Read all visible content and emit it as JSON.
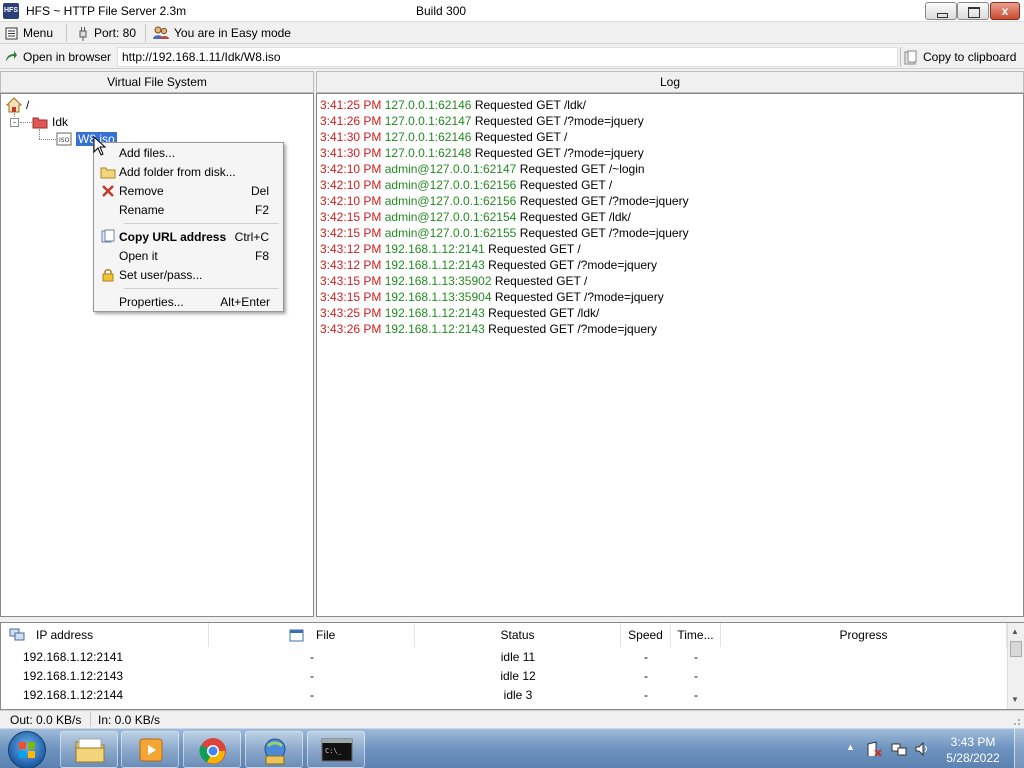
{
  "window": {
    "title": "HFS ~ HTTP File Server 2.3m",
    "build": "Build 300",
    "close_label": "x"
  },
  "toolbar": {
    "menu_label": "Menu",
    "port_label": "Port: 80",
    "mode_label": "You are in Easy mode"
  },
  "urlbar": {
    "open_label": "Open in browser",
    "url": "http://192.168.1.11/Idk/W8.iso",
    "copy_label": "Copy to clipboard"
  },
  "vfs": {
    "header": "Virtual File System",
    "root_label": "/",
    "folder_label": "Idk",
    "file_label": "W8.iso"
  },
  "context_menu": {
    "items": [
      {
        "label": "Add files...",
        "shortcut": "",
        "icon": "none"
      },
      {
        "label": "Add folder from disk...",
        "shortcut": "",
        "icon": "folder-icon"
      },
      {
        "label": "Remove",
        "shortcut": "Del",
        "icon": "remove-x-icon"
      },
      {
        "label": "Rename",
        "shortcut": "F2",
        "icon": "none"
      },
      {
        "label": "Copy URL address",
        "shortcut": "Ctrl+C",
        "icon": "copy-icon",
        "bold": true
      },
      {
        "label": "Open it",
        "shortcut": "F8",
        "icon": "none"
      },
      {
        "label": "Set user/pass...",
        "shortcut": "",
        "icon": "lock-icon"
      },
      {
        "label": "Properties...",
        "shortcut": "Alt+Enter",
        "icon": "none"
      }
    ]
  },
  "log": {
    "header": "Log",
    "entries": [
      {
        "time": "3:41:25 PM",
        "addr": "127.0.0.1:62146",
        "msg": "Requested GET /ldk/"
      },
      {
        "time": "3:41:26 PM",
        "addr": "127.0.0.1:62147",
        "msg": "Requested GET /?mode=jquery"
      },
      {
        "time": "3:41:30 PM",
        "addr": "127.0.0.1:62146",
        "msg": "Requested GET /"
      },
      {
        "time": "3:41:30 PM",
        "addr": "127.0.0.1:62148",
        "msg": "Requested GET /?mode=jquery"
      },
      {
        "time": "3:42:10 PM",
        "addr": "admin@127.0.0.1:62147",
        "msg": "Requested GET /~login"
      },
      {
        "time": "3:42:10 PM",
        "addr": "admin@127.0.0.1:62156",
        "msg": "Requested GET /"
      },
      {
        "time": "3:42:10 PM",
        "addr": "admin@127.0.0.1:62156",
        "msg": "Requested GET /?mode=jquery"
      },
      {
        "time": "3:42:15 PM",
        "addr": "admin@127.0.0.1:62154",
        "msg": "Requested GET /ldk/"
      },
      {
        "time": "3:42:15 PM",
        "addr": "admin@127.0.0.1:62155",
        "msg": "Requested GET /?mode=jquery"
      },
      {
        "time": "3:43:12 PM",
        "addr": "192.168.1.12:2141",
        "msg": "Requested GET /"
      },
      {
        "time": "3:43:12 PM",
        "addr": "192.168.1.12:2143",
        "msg": "Requested GET /?mode=jquery"
      },
      {
        "time": "3:43:15 PM",
        "addr": "192.168.1.13:35902",
        "msg": "Requested GET /"
      },
      {
        "time": "3:43:15 PM",
        "addr": "192.168.1.13:35904",
        "msg": "Requested GET /?mode=jquery"
      },
      {
        "time": "3:43:25 PM",
        "addr": "192.168.1.12:2143",
        "msg": "Requested GET /ldk/"
      },
      {
        "time": "3:43:26 PM",
        "addr": "192.168.1.12:2143",
        "msg": "Requested GET /?mode=jquery"
      }
    ]
  },
  "connections": {
    "columns": {
      "ip": "IP address",
      "file": "File",
      "status": "Status",
      "speed": "Speed",
      "time": "Time...",
      "progress": "Progress"
    },
    "rows": [
      {
        "ip": "192.168.1.12:2141",
        "file": "-",
        "status": "idle 11",
        "speed": "-",
        "time": "-",
        "progress": ""
      },
      {
        "ip": "192.168.1.12:2143",
        "file": "-",
        "status": "idle 12",
        "speed": "-",
        "time": "-",
        "progress": ""
      },
      {
        "ip": "192.168.1.12:2144",
        "file": "-",
        "status": "idle 3",
        "speed": "-",
        "time": "-",
        "progress": ""
      }
    ]
  },
  "status": {
    "out": "Out: 0.0 KB/s",
    "in": "In: 0.0 KB/s"
  },
  "taskbar": {
    "apps": [
      "file-explorer-icon",
      "media-player-icon",
      "chrome-icon",
      "hfs-icon",
      "command-prompt-icon"
    ],
    "time": "3:43 PM",
    "date": "5/28/2022"
  },
  "colors": {
    "log_time": "#d21b1b",
    "log_addr": "#228b22",
    "selection": "#3470d6"
  }
}
